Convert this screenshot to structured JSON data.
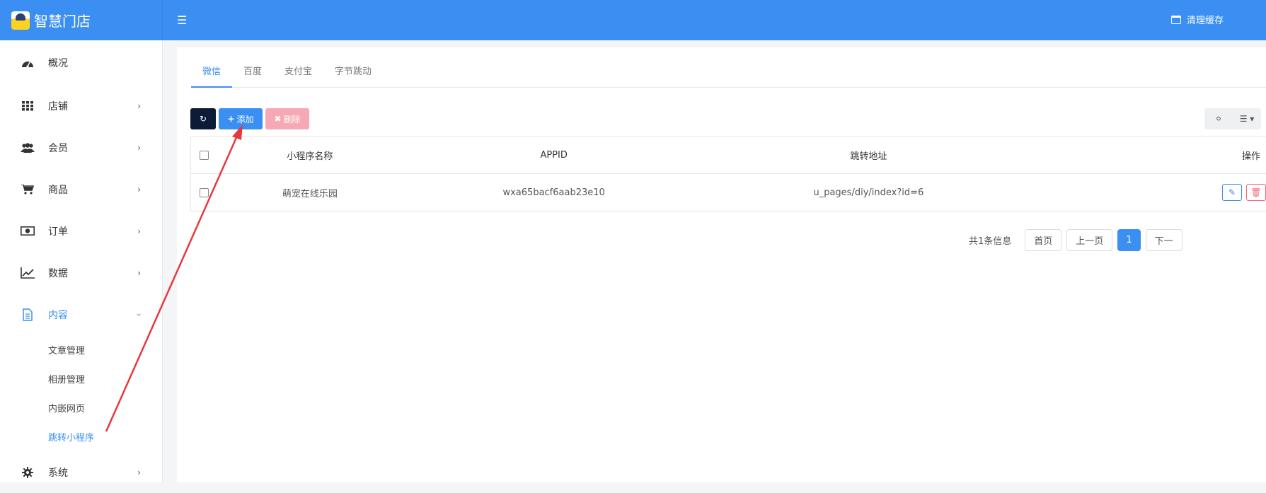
{
  "header": {
    "brand": "智慧门店",
    "clear_cache": "清理缓存"
  },
  "sidebar": {
    "items": [
      {
        "label": "概况",
        "icon": "dashboard-icon"
      },
      {
        "label": "店铺",
        "icon": "grid-icon"
      },
      {
        "label": "会员",
        "icon": "users-icon"
      },
      {
        "label": "商品",
        "icon": "cart-icon"
      },
      {
        "label": "订单",
        "icon": "money-icon"
      },
      {
        "label": "数据",
        "icon": "line-chart-icon"
      },
      {
        "label": "内容",
        "icon": "file-icon"
      },
      {
        "label": "系统",
        "icon": "gear-icon"
      }
    ],
    "sub_items": [
      "文章管理",
      "相册管理",
      "内嵌网页",
      "跳转小程序"
    ]
  },
  "tabs": [
    "微信",
    "百度",
    "支付宝",
    "字节跳动"
  ],
  "toolbar": {
    "add_label": "添加",
    "delete_label": "删除"
  },
  "table": {
    "headers": [
      "小程序名称",
      "APPID",
      "跳转地址",
      "操作"
    ],
    "rows": [
      {
        "name": "萌宠在线乐园",
        "appid": "wxa65bacf6aab23e10",
        "url": "u_pages/diy/index?id=6"
      }
    ]
  },
  "pagination": {
    "info": "共1条信息",
    "first": "首页",
    "prev": "上一页",
    "current": "1",
    "next": "下一"
  },
  "colors": {
    "primary": "#3b8ff3",
    "dark": "#0d1b36",
    "danger_light": "#f7a8b6",
    "annotation": "#e8383d"
  }
}
